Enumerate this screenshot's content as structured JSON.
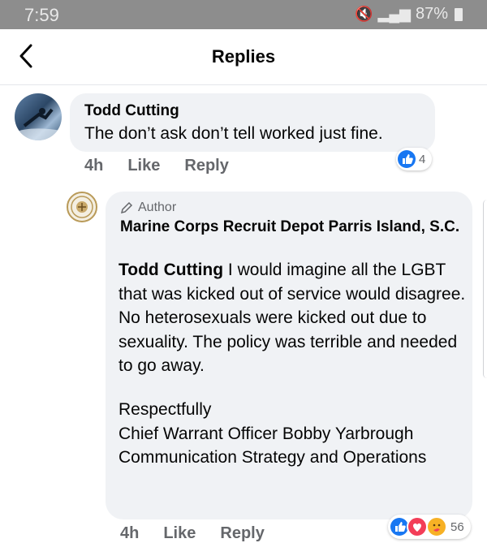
{
  "status_bar": {
    "time": "7:59",
    "battery": "87%"
  },
  "header": {
    "title": "Replies"
  },
  "comment": {
    "author": "Todd Cutting",
    "text": "The don’t ask don’t tell worked just fine.",
    "time": "4h",
    "like_label": "Like",
    "reply_label": "Reply",
    "reaction_count": "4"
  },
  "reply": {
    "badge": "Author",
    "author": "Marine Corps Recruit Depot Parris Island, S.C.",
    "mention": "Todd Cutting",
    "text": " I would imagine all the LGBT that was kicked out of service would disagree. No heterosexuals were kicked out due to sexuality. The policy was terrible and needed to go away.",
    "signoff": "Respectfully",
    "sig_name": "Chief Warrant Officer Bobby Yarbrough",
    "sig_title": "Communication Strategy and Operations",
    "time": "4h",
    "like_label": "Like",
    "reply_label": "Reply",
    "reaction_count": "56"
  },
  "colors": {
    "bubble": "#f0f2f5",
    "secondary_text": "#65676b",
    "like_blue": "#1877f2",
    "love_red": "#f33e58",
    "care_yellow": "#f7b125"
  }
}
